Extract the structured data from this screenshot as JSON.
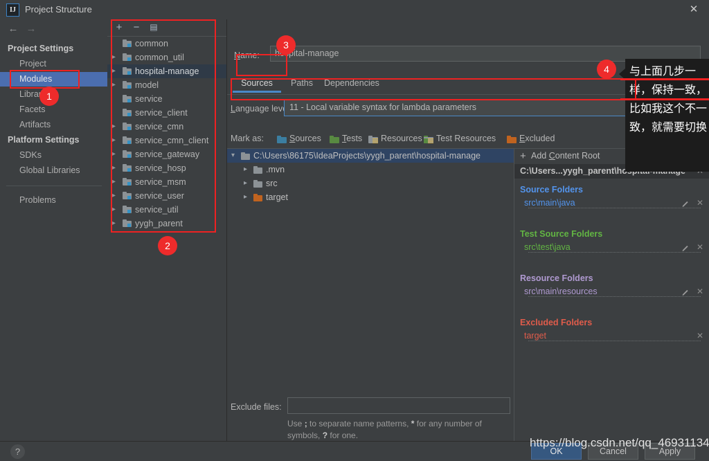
{
  "window": {
    "title": "Project Structure",
    "logo_text": "IJ",
    "close_icon": "✕"
  },
  "nav": {
    "back_icon": "←",
    "forward_icon": "→"
  },
  "sidebar": {
    "groups": [
      {
        "label": "Project Settings"
      },
      {
        "label": "Platform Settings"
      }
    ],
    "items": [
      {
        "label": "Project",
        "selected": false
      },
      {
        "label": "Modules",
        "selected": true
      },
      {
        "label": "Libraries",
        "selected": false
      },
      {
        "label": "Facets",
        "selected": false
      },
      {
        "label": "Artifacts",
        "selected": false
      },
      {
        "label": "SDKs",
        "selected": false
      },
      {
        "label": "Global Libraries",
        "selected": false
      },
      {
        "label": "Problems",
        "selected": false
      }
    ]
  },
  "modules_panel": {
    "toolbar": {
      "add_label": "+",
      "remove_label": "−",
      "copy_label": "▤"
    },
    "items": [
      {
        "label": "common",
        "expandable": false,
        "selected": false
      },
      {
        "label": "common_util",
        "expandable": true,
        "selected": false
      },
      {
        "label": "hospital-manage",
        "expandable": true,
        "selected": true
      },
      {
        "label": "model",
        "expandable": true,
        "selected": false
      },
      {
        "label": "service",
        "expandable": false,
        "selected": false
      },
      {
        "label": "service_client",
        "expandable": false,
        "selected": false
      },
      {
        "label": "service_cmn",
        "expandable": true,
        "selected": false
      },
      {
        "label": "service_cmn_client",
        "expandable": true,
        "selected": false
      },
      {
        "label": "service_gateway",
        "expandable": true,
        "selected": false
      },
      {
        "label": "service_hosp",
        "expandable": true,
        "selected": false
      },
      {
        "label": "service_msm",
        "expandable": true,
        "selected": false
      },
      {
        "label": "service_user",
        "expandable": true,
        "selected": false
      },
      {
        "label": "service_util",
        "expandable": true,
        "selected": false
      },
      {
        "label": "yygh_parent",
        "expandable": true,
        "selected": false
      }
    ]
  },
  "detail": {
    "name_label": "Name:",
    "name_value": "hospital-manage",
    "tabs": [
      {
        "label": "Sources",
        "active": true
      },
      {
        "label": "Paths",
        "active": false
      },
      {
        "label": "Dependencies",
        "active": false
      }
    ],
    "language_level_label": "Language level:",
    "language_level_value": "11 - Local variable syntax for lambda parameters",
    "mark_as_label": "Mark as:",
    "mark_as": [
      {
        "label": "Sources",
        "color": "#3b7ea1"
      },
      {
        "label": "Tests",
        "color": "#588a41"
      },
      {
        "label": "Resources",
        "color": "#8c9296"
      },
      {
        "label": "Test Resources",
        "color": "#7e9b5f"
      },
      {
        "label": "Excluded",
        "color": "#c0631f"
      }
    ],
    "content_tree": [
      {
        "label": "C:\\Users\\86175\\IdeaProjects\\yygh_parent\\hospital-manage",
        "depth": 0,
        "expanded": true,
        "selected": true,
        "color": "#8c9296"
      },
      {
        "label": ".mvn",
        "depth": 1,
        "expanded": false,
        "selected": false,
        "color": "#8c9296"
      },
      {
        "label": "src",
        "depth": 1,
        "expanded": false,
        "selected": false,
        "color": "#8c9296"
      },
      {
        "label": "target",
        "depth": 1,
        "expanded": false,
        "selected": false,
        "color": "#c0631f"
      }
    ],
    "add_content_root_label": "Add Content Root",
    "add_content_root_icon": "+",
    "content_root_title": "C:\\Users...yygh_parent\\hospital-manage",
    "folder_groups": [
      {
        "title": "Source Folders",
        "color": "#5394ec",
        "entries": [
          {
            "path": "src\\main\\java"
          }
        ]
      },
      {
        "title": "Test Source Folders",
        "color": "#62b543",
        "entries": [
          {
            "path": "src\\test\\java"
          }
        ]
      },
      {
        "title": "Resource Folders",
        "color": "#b09ad1",
        "entries": [
          {
            "path": "src\\main\\resources"
          }
        ]
      },
      {
        "title": "Excluded Folders",
        "color": "#e05c4b",
        "entries": [
          {
            "path": "target"
          }
        ]
      }
    ],
    "exclude_files_label": "Exclude files:",
    "exclude_files_value": "",
    "exclude_hint_1": "Use ",
    "exclude_hint_semicolon": ";",
    "exclude_hint_2": " to separate name patterns, ",
    "exclude_hint_star": "*",
    "exclude_hint_3": " for any number of symbols, ",
    "exclude_hint_question": "?",
    "exclude_hint_4": " for one."
  },
  "bottom": {
    "help_icon": "?",
    "ok_label": "OK",
    "cancel_label": "Cancel",
    "apply_label": "Apply"
  },
  "watermark": {
    "text": "https://blog.csdn.net/qq_46931134"
  },
  "annotation": {
    "note_text": "与上面几步一样，保持一致，比如我这个不一致，就需要切换",
    "badges": [
      {
        "number": "1"
      },
      {
        "number": "2"
      },
      {
        "number": "3"
      },
      {
        "number": "4"
      }
    ],
    "highlight_color": "#ee2222"
  }
}
